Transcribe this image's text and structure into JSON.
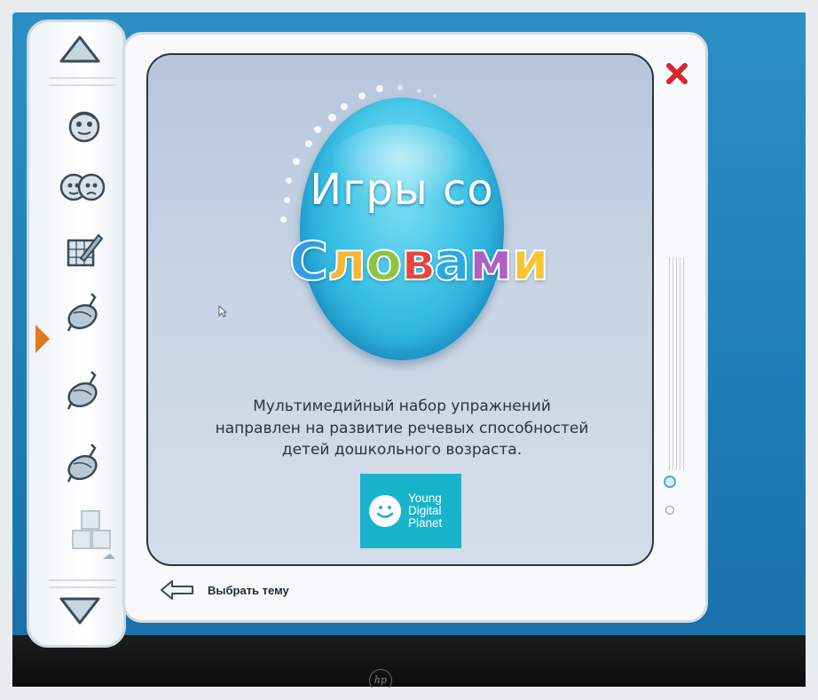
{
  "app": {
    "title_line1": "Игры со",
    "title_line2_letters": [
      {
        "ch": "С",
        "color": "#2f9fe2"
      },
      {
        "ch": "л",
        "color": "#f3b63a"
      },
      {
        "ch": "о",
        "color": "#8cc63f"
      },
      {
        "ch": "в",
        "color": "#e9443b"
      },
      {
        "ch": "а",
        "color": "#2ba7e6"
      },
      {
        "ch": "м",
        "color": "#b05fc5"
      },
      {
        "ch": "и",
        "color": "#f6c531"
      }
    ],
    "description_lines": [
      "Мультимедийный набор упражнений",
      "направлен на развитие речевых способностей",
      "детей дошкольного возраста."
    ],
    "publisher_logo": [
      "Young",
      "Digital",
      "Planet"
    ],
    "back_label": "Выбрать тему"
  },
  "toolbar": {
    "icons": [
      "scroll-up-icon",
      "face-icon",
      "two-faces-icon",
      "drawing-icon",
      "spinning-top-icon-1",
      "spinning-top-icon-2",
      "spinning-top-icon-3",
      "blocks-icon",
      "scroll-down-icon"
    ],
    "active_marker": "orange-triangle"
  },
  "colors": {
    "accent_orange": "#e07a1f",
    "close_red": "#d7262b",
    "ydp_teal": "#1ab3cc",
    "screen_blue": "#2a8bc2"
  },
  "device": {
    "brand": "hp"
  }
}
